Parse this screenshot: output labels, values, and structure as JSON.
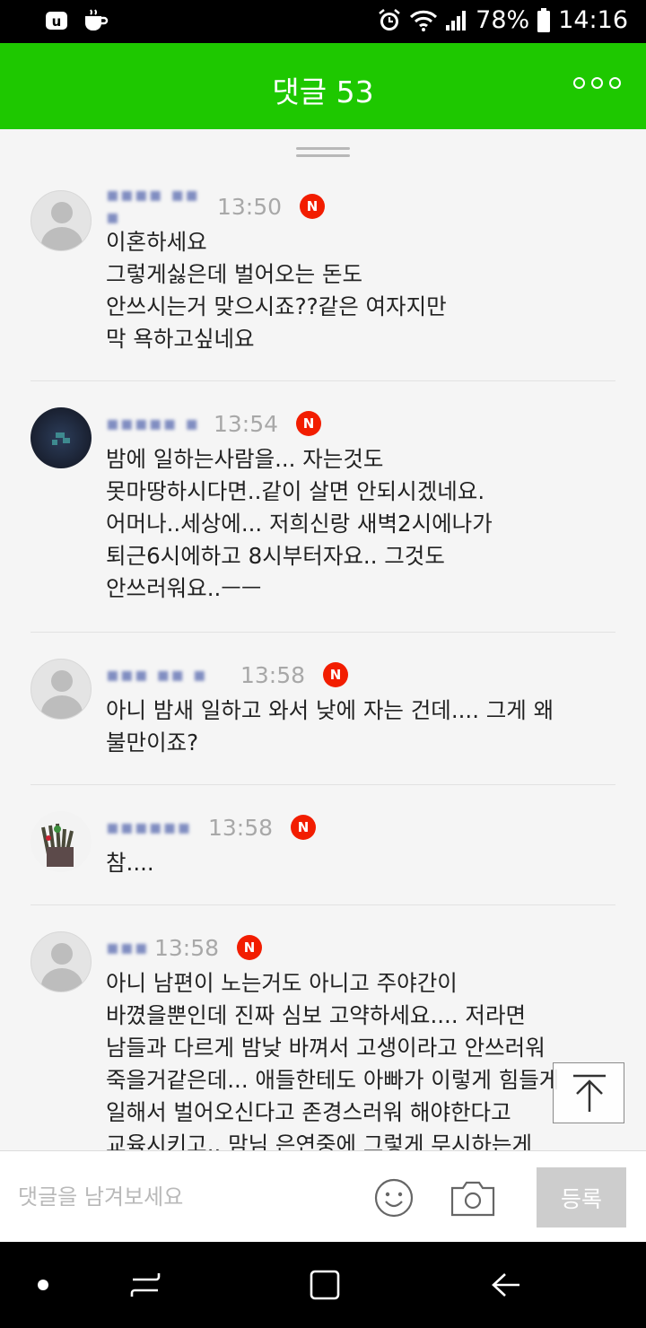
{
  "status_bar": {
    "battery": "78%",
    "time": "14:16",
    "icons": [
      "app-icon",
      "coffee-icon",
      "alarm-icon",
      "wifi-icon",
      "signal-icon",
      "battery-icon"
    ]
  },
  "header": {
    "title": "댓글 53",
    "background": "#1ec800",
    "more_icon": "more-horizontal-icon"
  },
  "comments": [
    {
      "avatar": "default-avatar",
      "time": "13:50",
      "badge": "N",
      "text": "이혼하세요\n그렇게싫은데 벌어오는 돈도\n안쓰시는거 맞으시죠??같은 여자지만\n막 욕하고싶네요"
    },
    {
      "avatar": "profile-avatar",
      "time": "13:54",
      "badge": "N",
      "text": "밤에 일하는사람을... 자는것도\n못마땅하시다면..같이 살면 안되시겠네요.\n어머나..세상에... 저희신랑 새벽2시에나가\n퇴근6시에하고 8시부터자요.. 그것도\n안쓰러워요..ㅡㅡ"
    },
    {
      "avatar": "default-avatar",
      "time": "13:58",
      "badge": "N",
      "text": "아니 밤새 일하고 와서 낮에 자는 건데.... 그게 왜\n불만이죠?"
    },
    {
      "avatar": "photo-avatar",
      "time": "13:58",
      "badge": "N",
      "text": "참...."
    },
    {
      "avatar": "default-avatar",
      "time": "13:58",
      "badge": "N",
      "text": "아니 남편이 노는거도 아니고 주야간이\n바꼈을뿐인데 진짜 심보 고약하세요.... 저라면\n남들과 다르게 밤낮 바껴서 고생이라고 안쓰러워\n죽을거같은데... 애들한테도 아빠가 이렇게 힘들게\n일해서 벌어오신다고 존경스러워 해야한다고\n교육시키고.. 맘님 은연중에 그렇게 무시하는게"
    }
  ],
  "badge_color": "#f21d00",
  "input": {
    "placeholder": "댓글을 남겨보세요",
    "value": "",
    "submit_label": "등록",
    "emoji_icon": "smiley-icon",
    "camera_icon": "camera-icon"
  },
  "scroll_top_icon": "arrow-up-icon",
  "nav": [
    "dot-icon",
    "recents-icon",
    "home-icon",
    "back-icon"
  ]
}
